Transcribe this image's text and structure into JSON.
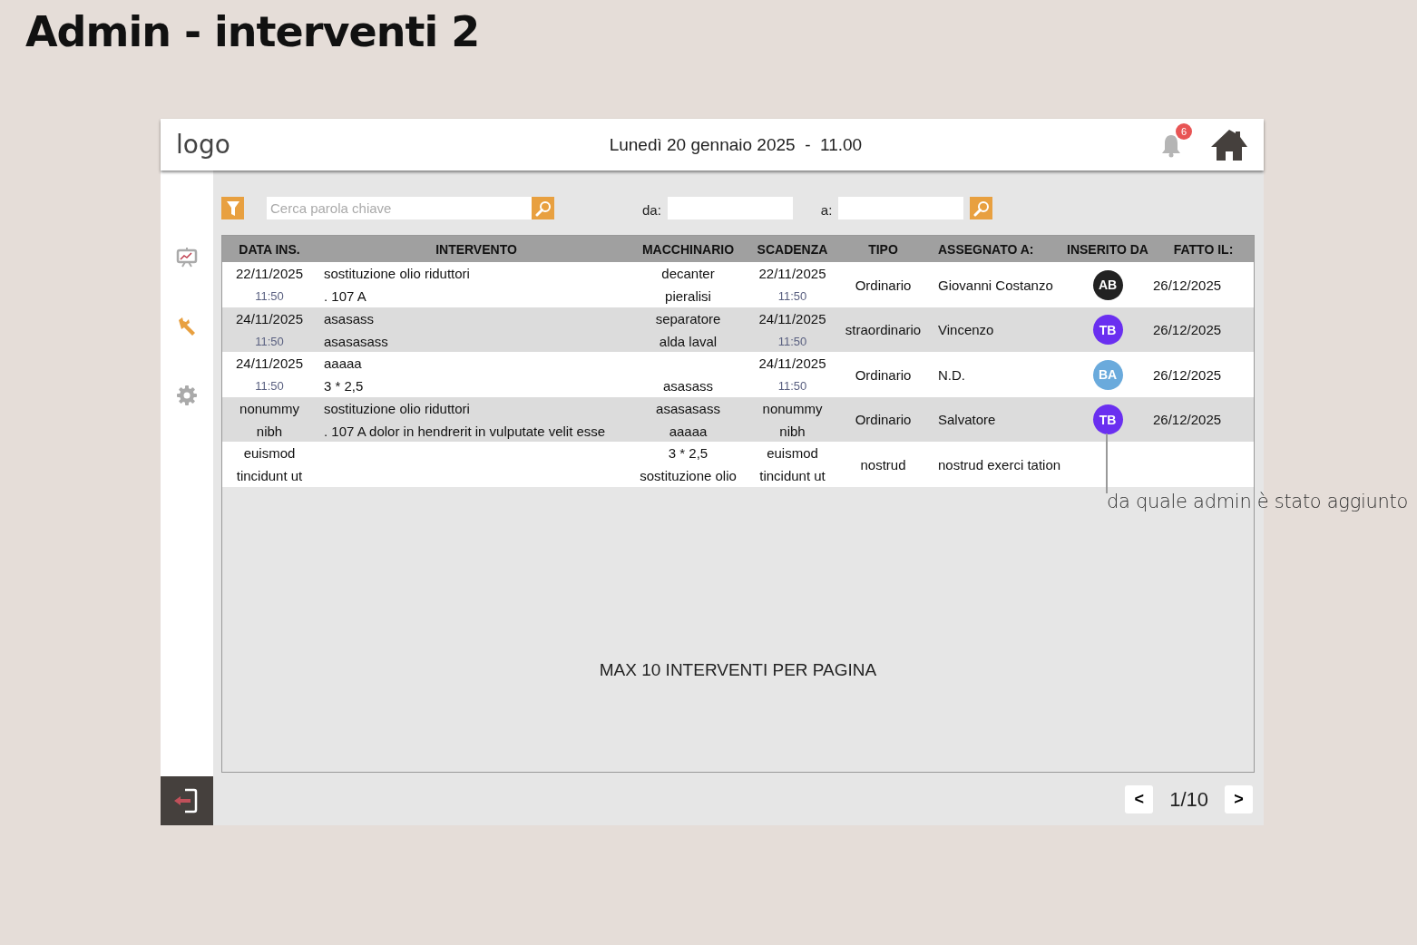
{
  "page_title": "Admin - interventi 2",
  "header": {
    "logo": "logo",
    "datetime": "Lunedì 20 gennaio 2025  -  11.00",
    "notifications": "6"
  },
  "sidebar": {
    "items": [
      {
        "kind": "chart",
        "selected": false
      },
      {
        "kind": "wrench",
        "selected": true
      },
      {
        "kind": "gear",
        "selected": false
      }
    ]
  },
  "filters": {
    "search_placeholder": "Cerca parola chiave",
    "from_label": "da:",
    "to_label": "a:"
  },
  "table": {
    "columns": [
      "DATA INS.",
      "INTERVENTO",
      "MACCHINARIO",
      "SCADENZA",
      "TIPO",
      "ASSEGNATO A:",
      "INSERITO DA",
      "FATTO IL:"
    ],
    "rows": [
      {
        "data_ins": {
          "top": "22/11/2025",
          "time": "11:50"
        },
        "intervento": {
          "top": "sostituzione olio riduttori",
          "bottom": ". 107 A"
        },
        "macchinario": {
          "top": "decanter",
          "bottom": "pieralisi"
        },
        "scadenza": {
          "top": "22/11/2025",
          "time": "11:50"
        },
        "tipo": "Ordinario",
        "assegnato": "Giovanni Costanzo",
        "inserito": {
          "initials": "AB",
          "color": "#222222"
        },
        "fatto": "26/12/2025"
      },
      {
        "data_ins": {
          "top": "24/11/2025",
          "time": "11:50"
        },
        "intervento": {
          "top": "asasass",
          "bottom": "asasasass"
        },
        "macchinario": {
          "top": "separatore",
          "bottom": "alda laval"
        },
        "scadenza": {
          "top": "24/11/2025",
          "time": "11:50"
        },
        "tipo": "straordinario",
        "assegnato": "Vincenzo",
        "inserito": {
          "initials": "TB",
          "color": "#6a2ff0"
        },
        "fatto": "26/12/2025"
      },
      {
        "data_ins": {
          "top": "24/11/2025",
          "time": "11:50"
        },
        "intervento": {
          "top": "aaaaa",
          "bottom": "3 * 2,5"
        },
        "macchinario": {
          "bottom": "asasass"
        },
        "scadenza": {
          "top": "24/11/2025",
          "time": "11:50"
        },
        "tipo": "Ordinario",
        "assegnato": "N.D.",
        "inserito": {
          "initials": "BA",
          "color": "#6aaadc"
        },
        "fatto": "26/12/2025"
      },
      {
        "data_ins": {
          "top": "nonummy",
          "bottom": "nibh"
        },
        "intervento": {
          "top": "sostituzione olio riduttori",
          "bottom": ". 107 A dolor in hendrerit in vulputate velit esse"
        },
        "macchinario": {
          "top": "asasasass",
          "bottom": "aaaaa"
        },
        "scadenza": {
          "top": "nonummy",
          "bottom": "nibh"
        },
        "tipo": "Ordinario",
        "assegnato": "Salvatore",
        "inserito": {
          "initials": "TB",
          "color": "#6a2ff0"
        },
        "fatto": "26/12/2025"
      },
      {
        "data_ins": {
          "top": "euismod",
          "bottom": "tincidunt ut"
        },
        "macchinario": {
          "top": "3 * 2,5",
          "bottom": "sostituzione olio"
        },
        "scadenza": {
          "top": "euismod",
          "bottom": "tincidunt ut"
        },
        "tipo": "nostrud",
        "assegnato": "nostrud exerci tation"
      }
    ],
    "note": "MAX 10 INTERVENTI PER PAGINA"
  },
  "annotation": "da quale admin è stato aggiunto",
  "pagination": {
    "prev": "<",
    "page": "1/10",
    "next": ">"
  }
}
